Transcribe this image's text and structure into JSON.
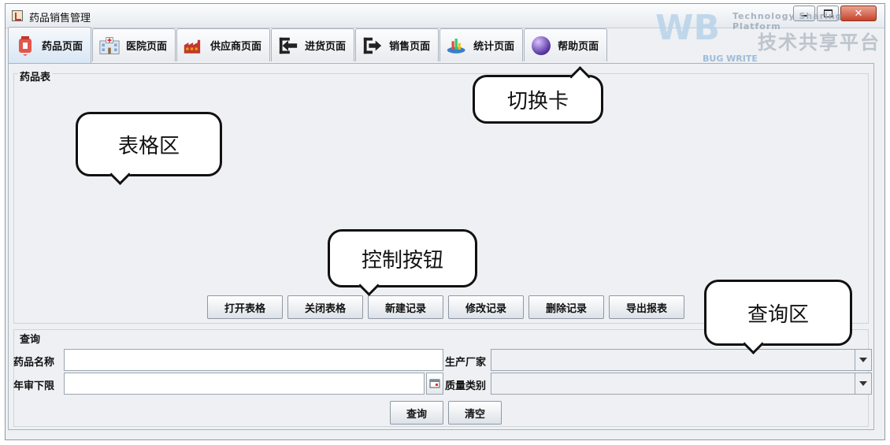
{
  "window": {
    "title": "药品销售管理"
  },
  "tabs": [
    {
      "label": "药品页面",
      "icon": "medicine-icon",
      "active": true
    },
    {
      "label": "医院页面",
      "icon": "hospital-icon",
      "active": false
    },
    {
      "label": "供应商页面",
      "icon": "factory-icon",
      "active": false
    },
    {
      "label": "进货页面",
      "icon": "import-arrow-icon",
      "active": false
    },
    {
      "label": "销售页面",
      "icon": "export-arrow-icon",
      "active": false
    },
    {
      "label": "统计页面",
      "icon": "chart-icon",
      "active": false
    },
    {
      "label": "帮助页面",
      "icon": "globe-icon",
      "active": false
    }
  ],
  "table_group": {
    "title": "药品表"
  },
  "control_buttons": [
    "打开表格",
    "关闭表格",
    "新建记录",
    "修改记录",
    "删除记录",
    "导出报表"
  ],
  "query": {
    "title": "查询",
    "drug_name_label": "药品名称",
    "drug_name_value": "",
    "manufacturer_label": "生产厂家",
    "manufacturer_value": "",
    "year_review_label": "年审下限",
    "year_review_value": "",
    "quality_label": "质量类别",
    "quality_value": "",
    "search_button": "查询",
    "clear_button": "清空"
  },
  "callouts": {
    "tabs": "切换卡",
    "table": "表格区",
    "controls": "控制按钮",
    "query": "查询区"
  },
  "watermark": {
    "letters": "WB",
    "sub": "BUG WRITE",
    "english": "Technology Sharing Platform",
    "chinese": "技术共享平台"
  },
  "colors": {
    "close_button": "#c8432a",
    "active_tab": "#d9e6f4"
  }
}
